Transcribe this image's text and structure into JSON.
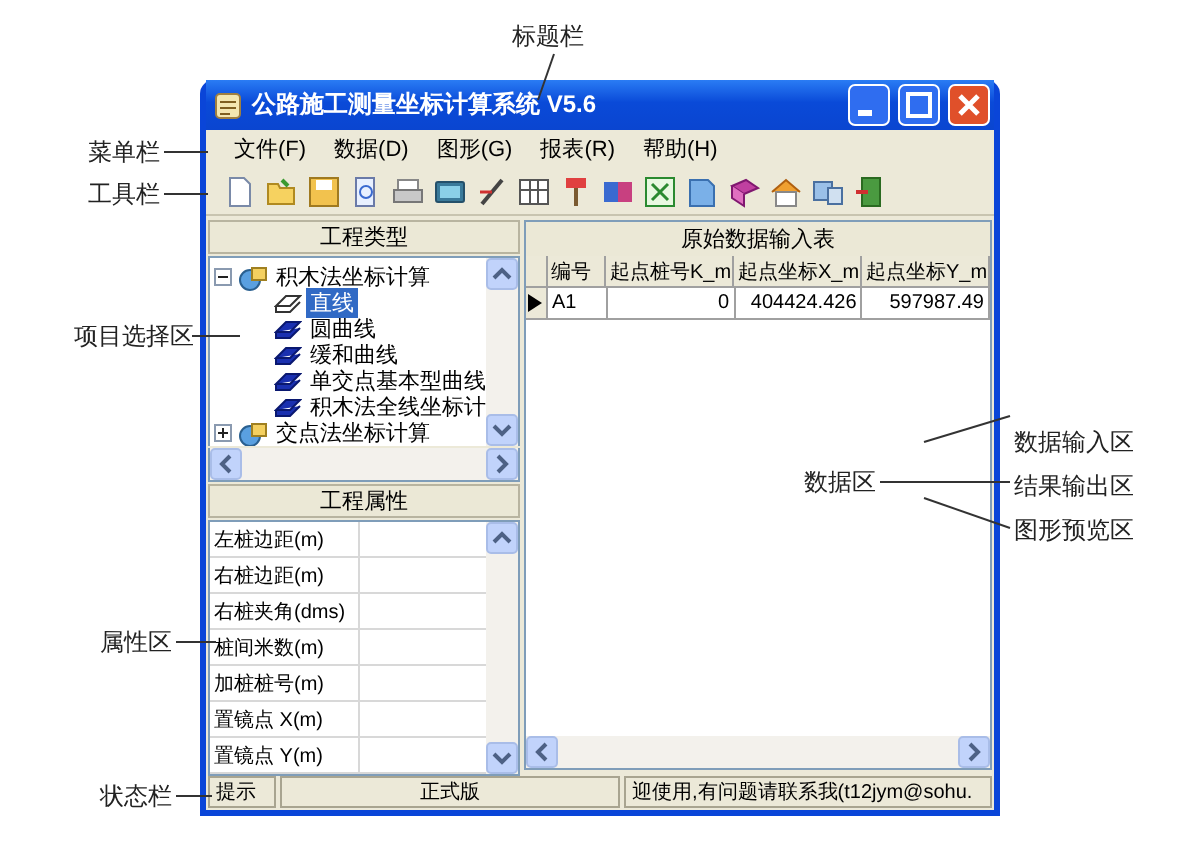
{
  "callouts": [
    {
      "text": "标题栏"
    },
    {
      "text": "菜单栏"
    },
    {
      "text": "工具栏"
    },
    {
      "text": "项目选择区"
    },
    {
      "text": "属性区"
    },
    {
      "text": "状态栏"
    },
    {
      "text": "数据区"
    },
    {
      "text": "数据输入区"
    },
    {
      "text": "结果输出区"
    },
    {
      "text": "图形预览区"
    }
  ],
  "window": {
    "title": "公路施工测量坐标计算系统 V5.6",
    "menu": [
      "文件(F)",
      "数据(D)",
      "图形(G)",
      "报表(R)",
      "帮助(H)"
    ],
    "tree_panel": {
      "header": "工程类型",
      "items": [
        {
          "label": "积木法坐标计算",
          "expanded": true,
          "children": [
            {
              "label": "直线",
              "selected": true
            },
            {
              "label": "圆曲线",
              "selected": false
            },
            {
              "label": "缓和曲线",
              "selected": false
            },
            {
              "label": "单交点基本型曲线",
              "selected": false
            },
            {
              "label": "积木法全线坐标计",
              "selected": false
            }
          ]
        },
        {
          "label": "交点法坐标计算",
          "expanded": false
        }
      ]
    },
    "property_panel": {
      "header": "工程属性",
      "rows": [
        {
          "label": "左桩边距(m)"
        },
        {
          "label": "右桩边距(m)"
        },
        {
          "label": "右桩夹角(dms)"
        },
        {
          "label": "桩间米数(m)"
        },
        {
          "label": "加桩桩号(m)"
        },
        {
          "label": "置镜点 X(m)"
        },
        {
          "label": "置镜点 Y(m)"
        }
      ]
    },
    "data_table": {
      "title": "原始数据输入表",
      "columns": [
        "编号",
        "起点桩号K_m",
        "起点坐标X_m",
        "起点坐标Y_m"
      ],
      "rows": [
        {
          "selected": true,
          "cells": [
            "A1",
            "0",
            "404424.426",
            "597987.49"
          ]
        }
      ]
    },
    "status_bar": [
      "提示",
      "正式版",
      "迎使用,有问题请联系我(t12jym@sohu."
    ]
  }
}
